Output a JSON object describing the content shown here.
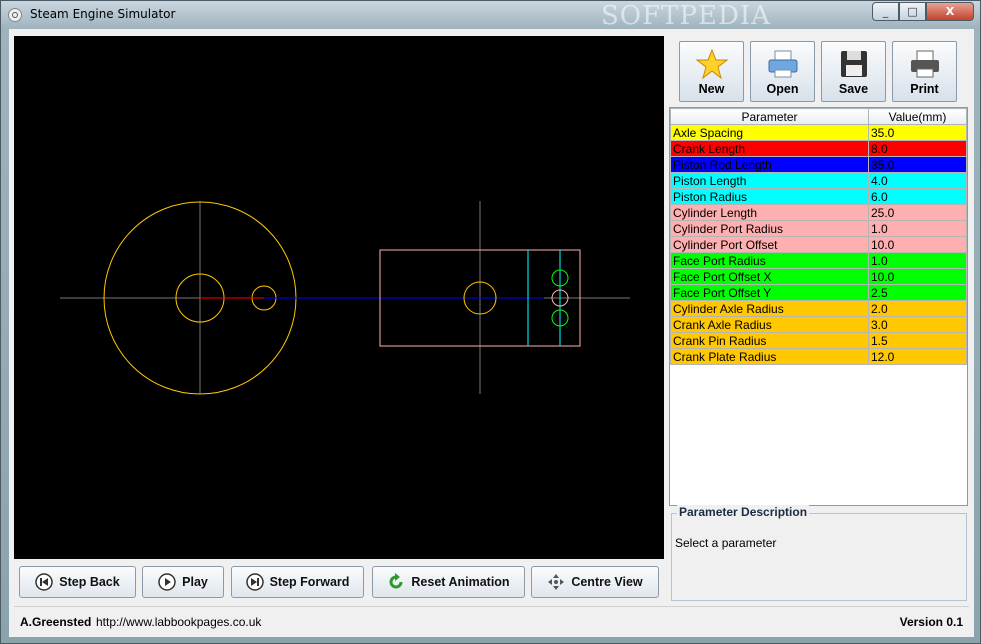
{
  "window": {
    "title": "Steam Engine Simulator",
    "watermark": "SOFTPEDIA",
    "controls": [
      "_",
      "□",
      "X"
    ]
  },
  "toolbar": {
    "new_label": "New",
    "open_label": "Open",
    "save_label": "Save",
    "print_label": "Print"
  },
  "table": {
    "headers": [
      "Parameter",
      "Value(mm)"
    ],
    "rows": [
      {
        "name": "Axle Spacing",
        "value": "35.0",
        "color": "#ffff00"
      },
      {
        "name": "Crank Length",
        "value": "8.0",
        "color": "#ff0000"
      },
      {
        "name": "Piston Rod Length",
        "value": "35.0",
        "color": "#0000ff"
      },
      {
        "name": "Piston Length",
        "value": "4.0",
        "color": "#00ffff"
      },
      {
        "name": "Piston Radius",
        "value": "6.0",
        "color": "#00ffff"
      },
      {
        "name": "Cylinder Length",
        "value": "25.0",
        "color": "#ffafaf"
      },
      {
        "name": "Cylinder Port Radius",
        "value": "1.0",
        "color": "#ffafaf"
      },
      {
        "name": "Cylinder Port Offset",
        "value": "10.0",
        "color": "#ffafaf"
      },
      {
        "name": "Face Port Radius",
        "value": "1.0",
        "color": "#00ff00"
      },
      {
        "name": "Face Port Offset X",
        "value": "10.0",
        "color": "#00ff00"
      },
      {
        "name": "Face Port Offset Y",
        "value": "2.5",
        "color": "#00ff00"
      },
      {
        "name": "Cylinder Axle Radius",
        "value": "2.0",
        "color": "#ffc800"
      },
      {
        "name": "Crank Axle Radius",
        "value": "3.0",
        "color": "#ffc800"
      },
      {
        "name": "Crank Pin Radius",
        "value": "1.5",
        "color": "#ffc800"
      },
      {
        "name": "Crank Plate Radius",
        "value": "12.0",
        "color": "#ffc800"
      }
    ]
  },
  "description": {
    "title": "Parameter Description",
    "text": "Select a parameter"
  },
  "controls": {
    "step_back": "Step Back",
    "play": "Play",
    "step_forward": "Step Forward",
    "reset": "Reset Animation",
    "centre": "Centre View"
  },
  "status": {
    "author": "A.Greensted",
    "url": "http://www.labbookpages.co.uk",
    "version": "Version 0.1"
  }
}
